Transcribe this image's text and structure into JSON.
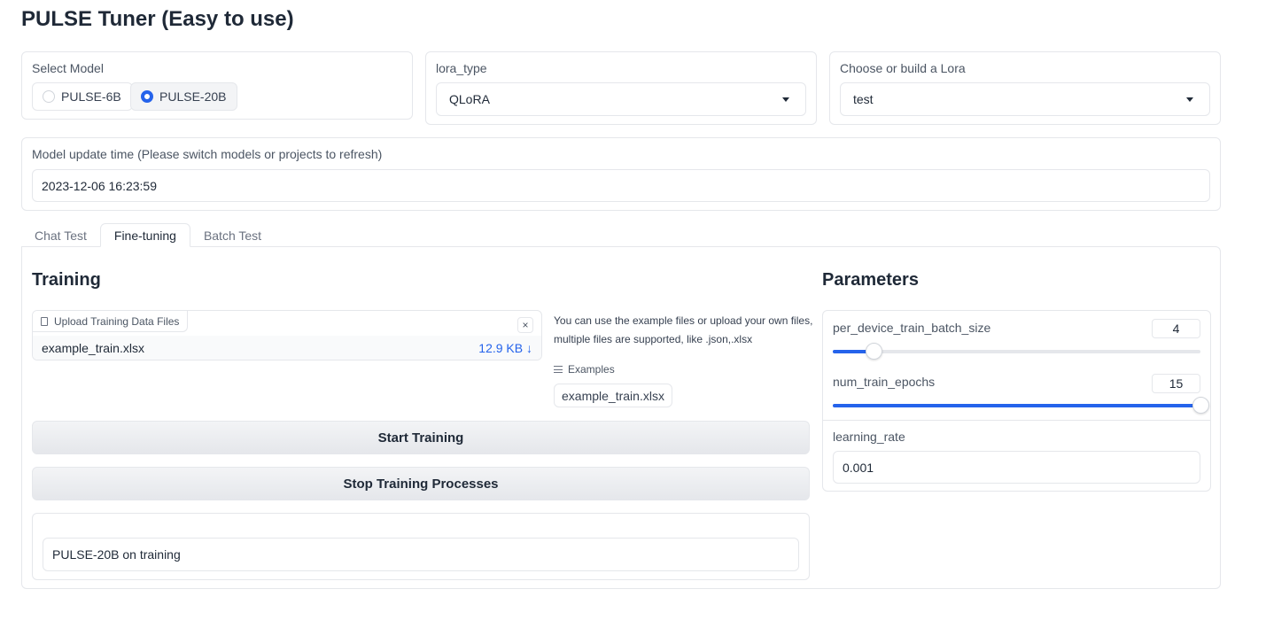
{
  "app": {
    "title": "PULSE Tuner (Easy to use)"
  },
  "model_select": {
    "label": "Select Model",
    "options": [
      {
        "label": "PULSE-6B",
        "checked": false
      },
      {
        "label": "PULSE-20B",
        "checked": true
      }
    ]
  },
  "lora_type": {
    "label": "lora_type",
    "value": "QLoRA"
  },
  "lora_choice": {
    "label": "Choose or build a Lora",
    "value": "test"
  },
  "update_time": {
    "label": "Model update time (Please switch models or projects to refresh)",
    "value": "2023-12-06 16:23:59"
  },
  "tabs": [
    {
      "label": "Chat Test",
      "active": false
    },
    {
      "label": "Fine-tuning",
      "active": true
    },
    {
      "label": "Batch Test",
      "active": false
    }
  ],
  "training": {
    "heading": "Training",
    "upload": {
      "label": "Upload Training Data Files",
      "file_name": "example_train.xlsx",
      "file_size": "12.9 KB ↓",
      "close_icon": "×"
    },
    "info_text": "You can use the example files or upload your own files, multiple files are supported, like .json,.xlsx",
    "examples_label": "Examples",
    "example_file": "example_train.xlsx",
    "start_button": "Start Training",
    "stop_button": "Stop Training Processes",
    "status": "PULSE-20B on training"
  },
  "parameters": {
    "heading": "Parameters",
    "batch_size": {
      "label": "per_device_train_batch_size",
      "value": "4",
      "slider_fraction": 0.11
    },
    "epochs": {
      "label": "num_train_epochs",
      "value": "15",
      "slider_fraction": 1.0
    },
    "learning_rate": {
      "label": "learning_rate",
      "value": "0.001"
    }
  },
  "colors": {
    "accent": "#2563eb",
    "border": "#e5e7eb"
  }
}
